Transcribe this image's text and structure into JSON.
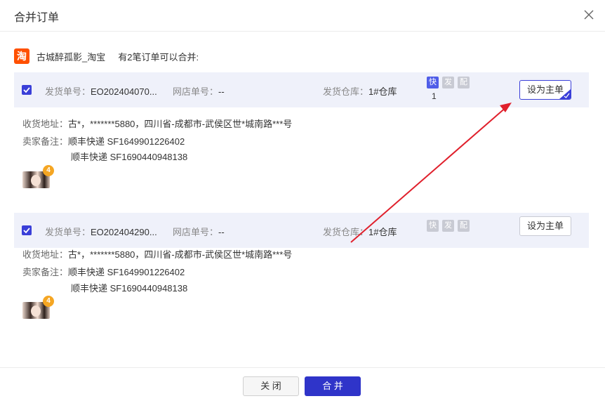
{
  "dialog": {
    "title": "合并订单",
    "close_icon": "close-icon"
  },
  "shop": {
    "logo_char": "淘",
    "name": "古城醉孤影_淘宝",
    "mergeable_text": "有2笔订单可以合并:"
  },
  "orders": [
    {
      "checked": true,
      "ship_no_label": "发货单号：",
      "ship_no": "EO202404070...",
      "store_no_label": "网店单号：",
      "store_no": "--",
      "warehouse_label": "发货仓库：",
      "warehouse": "1#仓库",
      "tags": [
        "快",
        "发",
        "配"
      ],
      "tag_count": "1",
      "set_main_label": "设为主单",
      "is_main": true,
      "address_label": "收货地址：",
      "address": "古*，*******5880，四川省-成都市-武侯区世*城南路***号",
      "remark_label": "卖家备注：",
      "remark_lines": [
        "顺丰快递 SF1649901226402",
        "顺丰快递 SF1690440948138"
      ],
      "item_badge": "4"
    },
    {
      "checked": true,
      "ship_no_label": "发货单号：",
      "ship_no": "EO202404290...",
      "store_no_label": "网店单号：",
      "store_no": "--",
      "warehouse_label": "发货仓库：",
      "warehouse": "1#仓库",
      "tags": [
        "快",
        "发",
        "配"
      ],
      "set_main_label": "设为主单",
      "is_main": false,
      "address_label": "收货地址：",
      "address": "古*，*******5880，四川省-成都市-武侯区世*城南路***号",
      "remark_label": "卖家备注：",
      "remark_lines": [
        "顺丰快递 SF1649901226402",
        "顺丰快递 SF1690440948138"
      ],
      "item_badge": "4"
    }
  ],
  "footer": {
    "close_label": "关 闭",
    "merge_label": "合 并"
  },
  "colors": {
    "accent": "#3a3fd8",
    "primary_button": "#2f34c9",
    "order_bar_bg": "#eff1fa",
    "tag_active": "#4f5de8",
    "tag_inactive": "#c8cad3",
    "badge": "#f5a623",
    "taobao": "#ff5000",
    "annotation_arrow": "#e0202c"
  }
}
